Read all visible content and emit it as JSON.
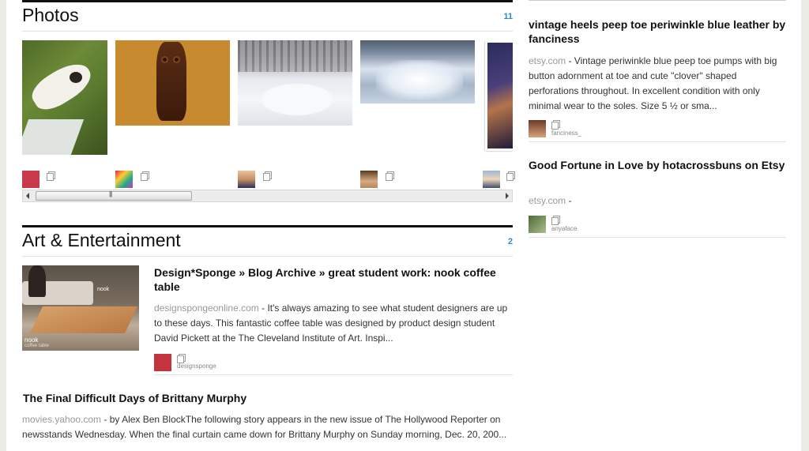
{
  "photos": {
    "title": "Photos",
    "count": "11",
    "items": [
      {
        "name": "cat-photo"
      },
      {
        "name": "carved-owl-photo"
      },
      {
        "name": "snow-photo"
      },
      {
        "name": "waterfall-photo"
      },
      {
        "name": "night-photo"
      }
    ],
    "users": [
      {
        "avatar_color": "#c9394c"
      },
      {
        "avatar_color": "#d9a12f"
      },
      {
        "avatar_color": "#c78f63"
      },
      {
        "avatar_color": "#b6875f"
      },
      {
        "avatar_color": "#3d4e6f"
      }
    ]
  },
  "art": {
    "title": "Art & Entertainment",
    "count": "2",
    "image_caption_top": "nook",
    "image_caption_bottom": "nook",
    "image_caption_sub": "coffee table",
    "story1": {
      "title": "Design*Sponge » Blog Archive » great student work: nook coffee table",
      "source": "designspongeonline.com",
      "sep": " - ",
      "excerpt": "It's always amazing to see what student designers are up to these days. This fantastic coffee table was designed by product design student David Pickett at the The Cleveland Institute of Art. Inspi...",
      "user": "designsponge",
      "avatar_color": "#c4343f"
    },
    "story2": {
      "title": "The Final Difficult Days of Brittany Murphy",
      "source": "movies.yahoo.com",
      "sep": " - ",
      "excerpt": "by Alex Ben BlockThe following story appears in the new issue of The Hollywood Reporter on newsstands Wednesday. When the final curtain came down for Brittany Murphy on Sunday morning, Dec. 20, 200..."
    }
  },
  "right": {
    "story1": {
      "title": "vintage heels peep toe periwinkle blue leather by fanciness",
      "source": "etsy.com",
      "sep": " - ",
      "excerpt": "Vintage periwinkle blue peep toe pumps with big button adornment at toe and cute \"clover\" shaped perforations throughout. In excellent condition with only minimal wear to the soles. Size 5 ½ or sma...",
      "user": "fanciness_",
      "avatar_color": "#6a3a28"
    },
    "story2": {
      "title": "Good Fortune in Love by hotacrossbuns on Etsy",
      "source": "etsy.com",
      "sep": " -",
      "excerpt": "",
      "user": "anyaface",
      "avatar_color": "#4c6a3a"
    }
  },
  "scrollbar": {
    "thumb_glyph": "|||"
  },
  "colors": {
    "accent": "#2a8ad4",
    "source_gray": "#999999",
    "rule": "#111111"
  }
}
